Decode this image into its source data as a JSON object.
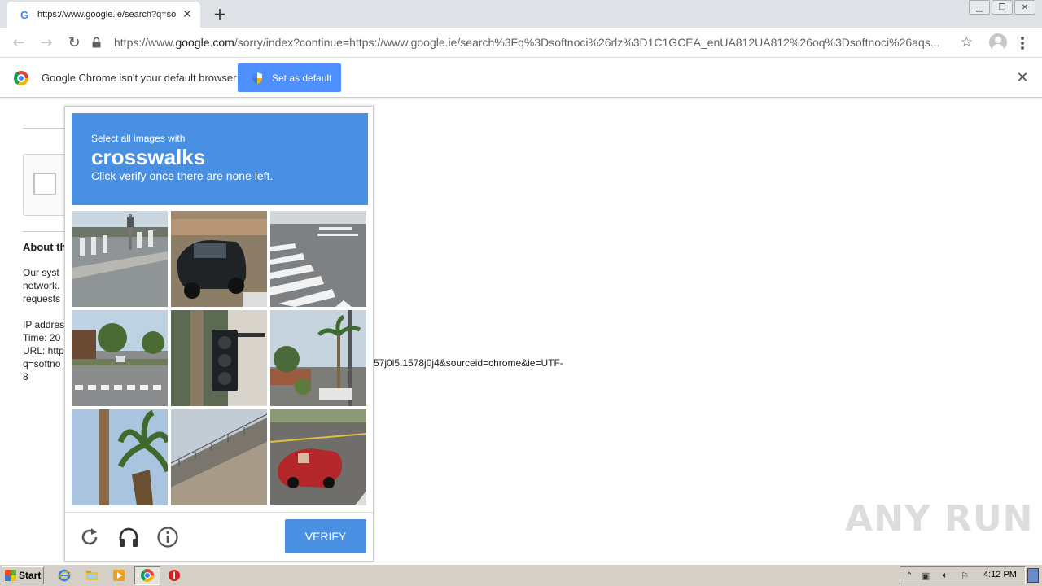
{
  "browser": {
    "tab_title": "https://www.google.ie/search?q=so",
    "tab_favicon": "G",
    "url_scheme": "https://www.",
    "url_host": "google.com",
    "url_rest": "/sorry/index?continue=https://www.google.ie/search%3Fq%3Dsoftnoci%26rlz%3D1C1GCEA_enUA812UA812%26oq%3Dsoftnoci%26aqs..."
  },
  "infobar": {
    "message": "Google Chrome isn't your default browser",
    "button_label": "Set as default"
  },
  "page": {
    "about_heading": "About th",
    "lines_a": [
      "Our syst",
      "network.",
      "requests"
    ],
    "lines_b": [
      "IP addres",
      "Time: 20",
      "URL: http",
      "q=softno",
      "8"
    ],
    "url_tail": "57j0l5.1578j0j4&sourceid=chrome&ie=UTF-"
  },
  "captcha": {
    "instruction": "Select all images with",
    "target": "crosswalks",
    "subtext": "Click verify once there are none left.",
    "verify_label": "VERIFY",
    "tiles": [
      {
        "name": "tile-street-corner-crosswalk"
      },
      {
        "name": "tile-black-suv"
      },
      {
        "name": "tile-crosswalk-stripes"
      },
      {
        "name": "tile-residential-crosswalk"
      },
      {
        "name": "tile-traffic-light"
      },
      {
        "name": "tile-palm-tree-street"
      },
      {
        "name": "tile-palm-tree"
      },
      {
        "name": "tile-overpass-bridge"
      },
      {
        "name": "tile-red-convertible"
      }
    ]
  },
  "watermark": "ANY RUN",
  "taskbar": {
    "start_label": "Start",
    "clock": "4:12 PM"
  },
  "colors": {
    "captcha_blue": "#4a90e2",
    "default_btn_blue": "#4d90fe",
    "tab_strip": "#dee1e6",
    "taskbar": "#d4d0c8"
  }
}
